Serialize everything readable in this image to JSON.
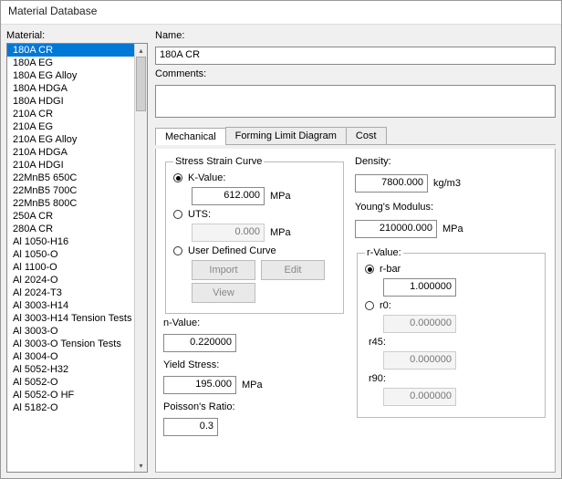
{
  "window": {
    "title": "Material Database"
  },
  "left": {
    "label": "Material:",
    "items": [
      "180A CR",
      "180A EG",
      "180A EG Alloy",
      "180A HDGA",
      "180A HDGI",
      "210A CR",
      "210A EG",
      "210A EG Alloy",
      "210A HDGA",
      "210A HDGI",
      "22MnB5 650C",
      "22MnB5 700C",
      "22MnB5 800C",
      "250A CR",
      "280A CR",
      "Al 1050-H16",
      "Al 1050-O",
      "Al 1100-O",
      "Al 2024-O",
      "Al 2024-T3",
      "Al 3003-H14",
      "Al 3003-H14 Tension Tests",
      "Al 3003-O",
      "Al 3003-O Tension Tests",
      "Al 3004-O",
      "Al 5052-H32",
      "Al 5052-O",
      "Al 5052-O HF",
      "Al 5182-O"
    ],
    "selected_index": 0
  },
  "name": {
    "label": "Name:",
    "value": "180A CR"
  },
  "comments": {
    "label": "Comments:",
    "value": ""
  },
  "tabs": [
    {
      "label": "Mechanical",
      "active": true
    },
    {
      "label": "Forming Limit Diagram",
      "active": false
    },
    {
      "label": "Cost",
      "active": false
    }
  ],
  "mech": {
    "ssc": {
      "legend": "Stress Strain Curve",
      "kvalue_label": "K-Value:",
      "kvalue": "612.000",
      "kvalue_unit": "MPa",
      "uts_label": "UTS:",
      "uts": "0.000",
      "uts_unit": "MPa",
      "userdef_label": "User Defined Curve",
      "btn_import": "Import",
      "btn_edit": "Edit",
      "btn_view": "View"
    },
    "nvalue": {
      "label": "n-Value:",
      "value": "0.220000"
    },
    "yield": {
      "label": "Yield Stress:",
      "value": "195.000",
      "unit": "MPa"
    },
    "poisson": {
      "label": "Poisson's Ratio:",
      "value": "0.3"
    },
    "density": {
      "label": "Density:",
      "value": "7800.000",
      "unit": "kg/m3"
    },
    "youngs": {
      "label": "Young's Modulus:",
      "value": "210000.000",
      "unit": "MPa"
    },
    "rvalue": {
      "legend": "r-Value:",
      "rbar_label": "r-bar",
      "rbar": "1.000000",
      "r0_label": "r0:",
      "r0": "0.000000",
      "r45_label": "r45:",
      "r45": "0.000000",
      "r90_label": "r90:",
      "r90": "0.000000"
    }
  }
}
